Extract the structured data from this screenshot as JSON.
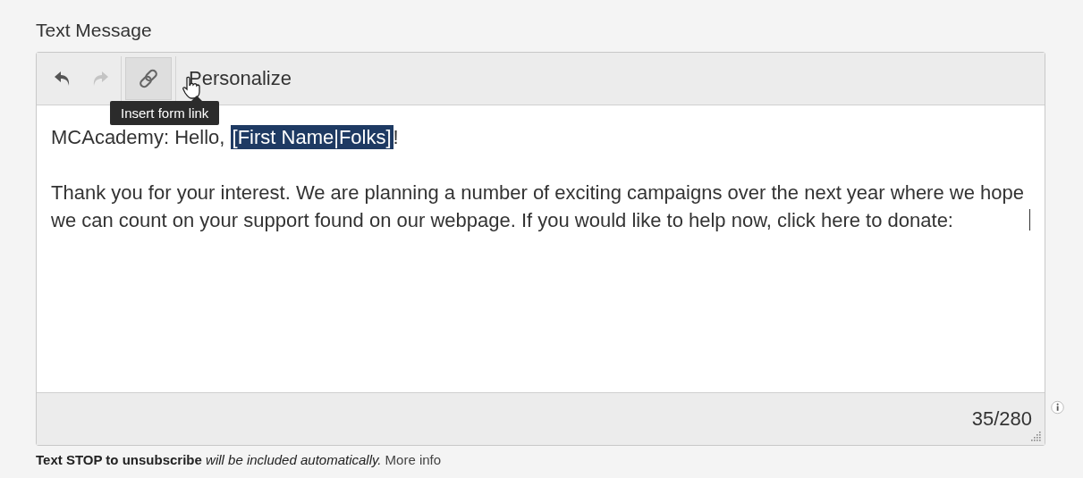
{
  "section_label": "Text Message",
  "toolbar": {
    "undo": {
      "disabled": false
    },
    "redo": {
      "disabled": true
    },
    "link_button": {
      "active": true,
      "tooltip": "Insert form link"
    },
    "personalize": "Personalize"
  },
  "message": {
    "greeting_before": "MCAcademy: Hello, ",
    "merge_tag": {
      "text": "[First Name|Folks]",
      "selected": true
    },
    "greeting_after": "!",
    "body": "Thank you for your interest. We are planning a number of exciting campaigns over the next year where we hope we can count on your support found on our webpage. If you would like to help now, click here to donate:"
  },
  "counter": "35/280",
  "footer_note": "**Text STOP to unsubscribe** *will be included automatically.*",
  "more_info": "More info"
}
